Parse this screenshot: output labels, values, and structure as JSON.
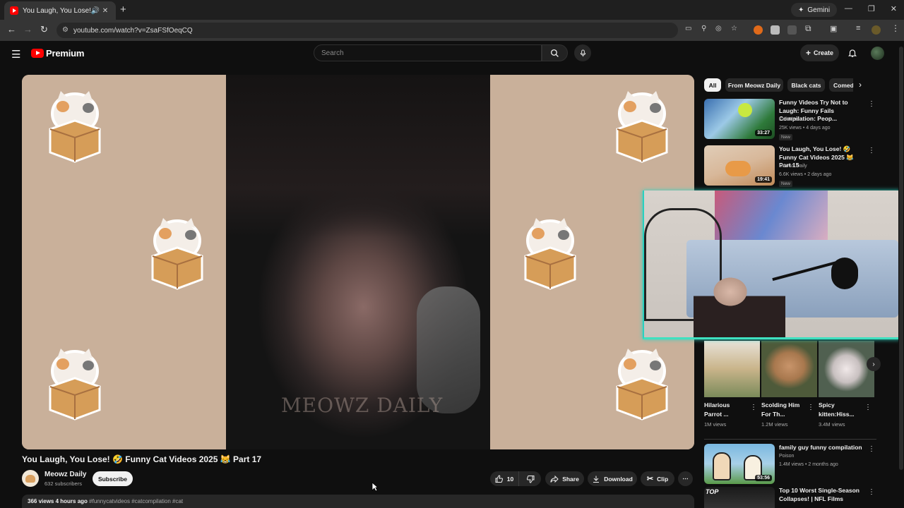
{
  "browser": {
    "tab_title": "You Laugh, You Lose! 🤣 Fu",
    "gemini_label": "Gemini",
    "url": "youtube.com/watch?v=ZsaFSfOeqCQ"
  },
  "header": {
    "brand": "Premium",
    "search_placeholder": "Search",
    "create_label": "Create"
  },
  "video": {
    "title": "You Laugh, You Lose! 🤣 Funny Cat Videos 2025 😹 Part 17",
    "watermark": "MEOWZ DAILY",
    "channel_name": "Meowz Daily",
    "subscribers": "632 subscribers",
    "subscribe_label": "Subscribe",
    "likes": "10",
    "share_label": "Share",
    "download_label": "Download",
    "clip_label": "Clip",
    "views_time": "366 views  4 hours ago",
    "tags": "#funnycatvideos #catcompilation #cat"
  },
  "chips": [
    "All",
    "From Meowz Daily",
    "Black cats",
    "Comed"
  ],
  "recommendations": [
    {
      "title": "Funny Videos Try Not to Laugh: Funny Fails Compilation: Peop...",
      "channel": "Fail Alert",
      "meta": "25K views • 4 days ago",
      "badge": "New",
      "duration": "33:27"
    },
    {
      "title": "You Laugh, You Lose! 🤣 Funny Cat Videos 2025 😹 Part 15",
      "channel": "Meowz Daily",
      "meta": "6.6K views • 2 days ago",
      "badge": "New",
      "duration": "19:41"
    },
    {
      "title": "family  guy funny compilation",
      "channel": "Poison",
      "meta": "1.4M views • 2 months ago",
      "badge": "",
      "duration": "53:56"
    },
    {
      "title": "Top 10 Worst Single-Season Collapses! | NFL Films",
      "channel": "",
      "meta": "",
      "badge": "",
      "duration": ""
    }
  ],
  "shorts": [
    {
      "title": "Hilarious Parrot ...",
      "views": "1M views"
    },
    {
      "title": "Scolding Him For Th...",
      "views": "1.2M views"
    },
    {
      "title": "Spicy kitten:Hiss...",
      "views": "3.4M views"
    }
  ],
  "colors": {
    "accent_red": "#ff0000",
    "webcam_border": "#3fe0c0",
    "background": "#0f0f0f"
  }
}
